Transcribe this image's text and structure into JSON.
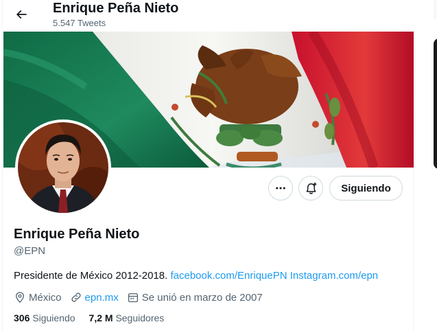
{
  "header": {
    "back_label": "Back",
    "title": "Enrique Peña Nieto",
    "tweet_count": "5.547 Tweets"
  },
  "profile": {
    "name": "Enrique Peña Nieto",
    "handle": "@EPN",
    "bio_text": "Presidente de México 2012-2018. ",
    "bio_links": [
      "facebook.com/EnriquePN",
      "Instagram.com/epn"
    ],
    "location": "México",
    "website": "epn.mx",
    "joined": "Se unió en marzo de 2007",
    "following_count": "306",
    "following_label": "Siguiendo",
    "followers_count": "7,2 M",
    "followers_label": "Seguidores"
  },
  "actions": {
    "more_icon": "more-icon",
    "notify_icon": "bell-plus-icon",
    "follow_button": "Siguiendo"
  },
  "colors": {
    "accent": "#1d9bf0",
    "text": "#0f1419",
    "muted": "#536471",
    "flag_green": "#006847",
    "flag_red": "#ce1126"
  }
}
